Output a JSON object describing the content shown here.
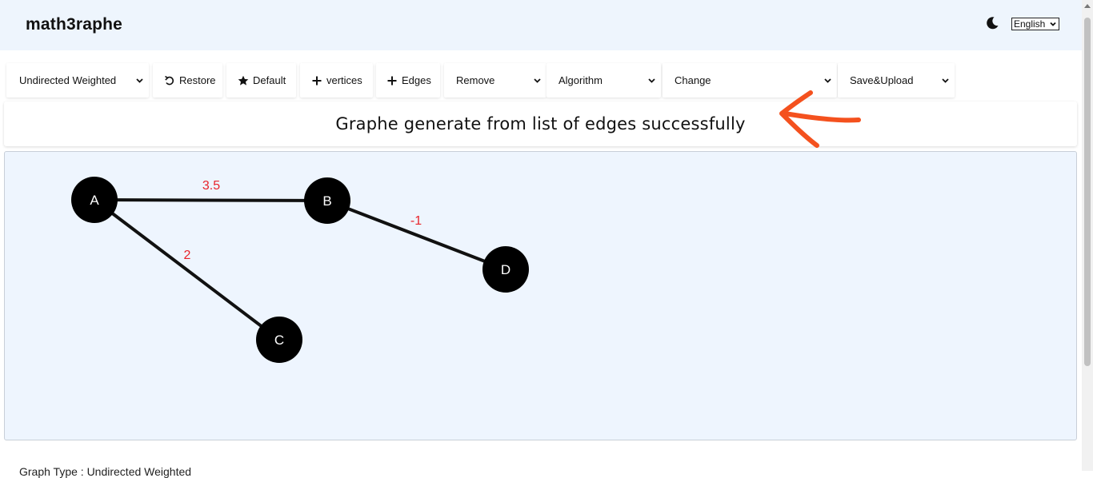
{
  "header": {
    "title": "math3raphe",
    "theme_icon": "moon-icon",
    "language": "English"
  },
  "toolbar": {
    "graph_type": "Undirected Weighted",
    "restore": "Restore",
    "default": "Default",
    "add_vertices": "vertices",
    "add_edges": "Edges",
    "remove": "Remove",
    "algorithm": "Algorithm",
    "change": "Change",
    "save_upload": "Save&Upload"
  },
  "message": "Graphe generate from list of edges successfully",
  "graph": {
    "vertices": [
      "A",
      "B",
      "C",
      "D"
    ],
    "edges": [
      {
        "from": "A",
        "to": "B",
        "weight": "3.5"
      },
      {
        "from": "A",
        "to": "C",
        "weight": "2"
      },
      {
        "from": "B",
        "to": "D",
        "weight": "-1"
      }
    ],
    "weight_color": "#e8232b",
    "node_color": "#000000"
  },
  "footer": {
    "graph_type_text": "Graph Type : Undirected Weighted"
  },
  "colors": {
    "header_bg": "#eef5fd",
    "canvas_bg": "#eef5fe",
    "arrow": "#f4511e"
  }
}
